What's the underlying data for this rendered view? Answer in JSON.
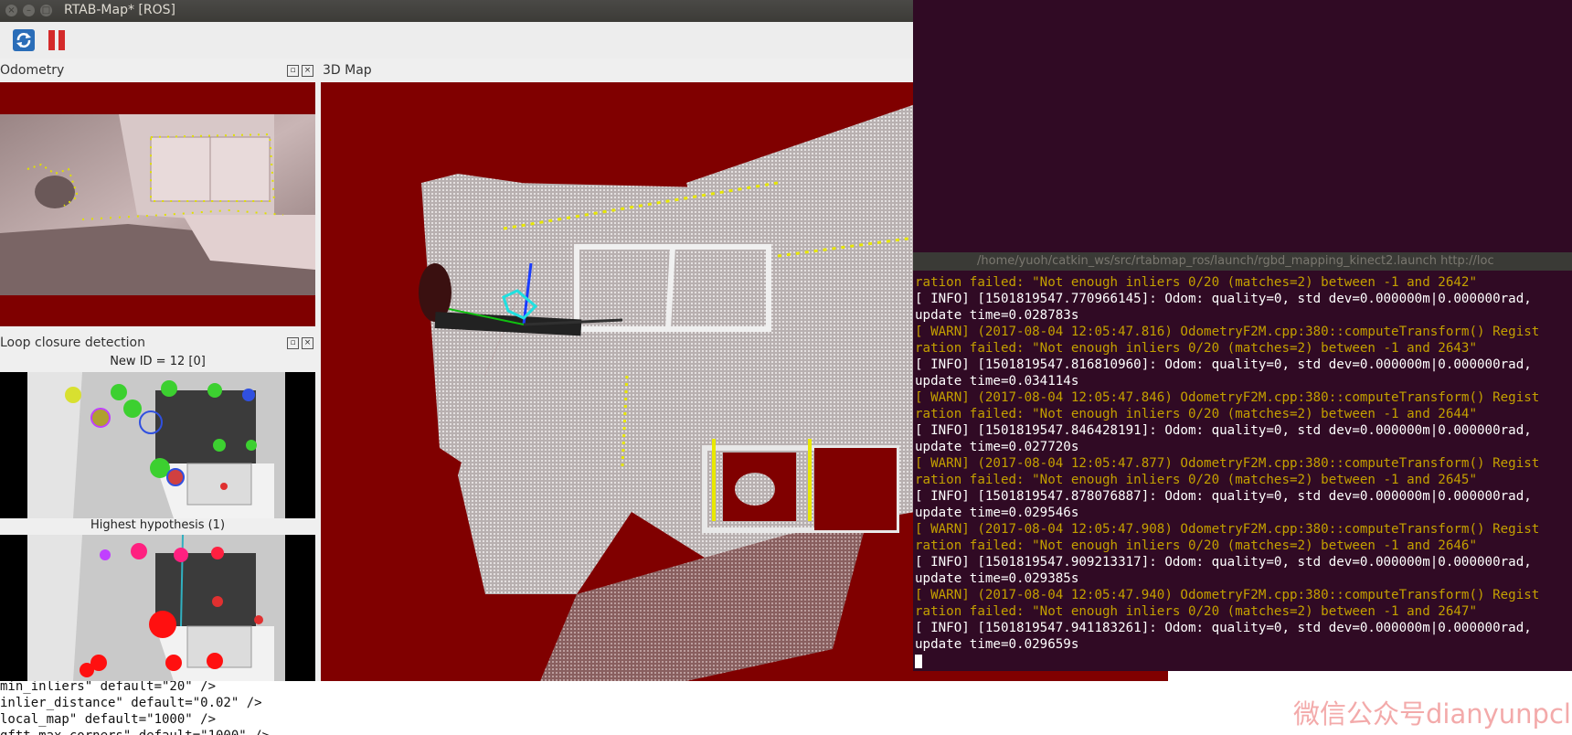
{
  "window": {
    "title": "RTAB-Map* [ROS]"
  },
  "toolbar": {
    "refresh_icon": "refresh-icon",
    "pause_icon": "pause-icon"
  },
  "docks": {
    "odometry": {
      "title": "Odometry"
    },
    "map3d": {
      "title": "3D Map"
    },
    "loop": {
      "title": "Loop closure detection",
      "new_id_caption": "New ID = 12 [0]",
      "hypothesis_caption": "Highest hypothesis (1)"
    }
  },
  "colors": {
    "view_background": "#800000",
    "terminal_bg": "#300a24",
    "warn": "#c4a000",
    "info": "#ffffff"
  },
  "terminal": {
    "title": "/home/yuoh/catkin_ws/src/rtabmap_ros/launch/rgbd_mapping_kinect2.launch http://loc",
    "lines": [
      {
        "type": "warn",
        "text": "ration failed: \"Not enough inliers 0/20 (matches=2) between -1 and 2642\""
      },
      {
        "type": "info",
        "text": "[ INFO] [1501819547.770966145]: Odom: quality=0, std dev=0.000000m|0.000000rad,"
      },
      {
        "type": "info",
        "text": "update time=0.028783s"
      },
      {
        "type": "warn",
        "text": "[ WARN] (2017-08-04 12:05:47.816) OdometryF2M.cpp:380::computeTransform() Regist"
      },
      {
        "type": "warn",
        "text": "ration failed: \"Not enough inliers 0/20 (matches=2) between -1 and 2643\""
      },
      {
        "type": "info",
        "text": "[ INFO] [1501819547.816810960]: Odom: quality=0, std dev=0.000000m|0.000000rad,"
      },
      {
        "type": "info",
        "text": "update time=0.034114s"
      },
      {
        "type": "warn",
        "text": "[ WARN] (2017-08-04 12:05:47.846) OdometryF2M.cpp:380::computeTransform() Regist"
      },
      {
        "type": "warn",
        "text": "ration failed: \"Not enough inliers 0/20 (matches=2) between -1 and 2644\""
      },
      {
        "type": "info",
        "text": "[ INFO] [1501819547.846428191]: Odom: quality=0, std dev=0.000000m|0.000000rad,"
      },
      {
        "type": "info",
        "text": "update time=0.027720s"
      },
      {
        "type": "warn",
        "text": "[ WARN] (2017-08-04 12:05:47.877) OdometryF2M.cpp:380::computeTransform() Regist"
      },
      {
        "type": "warn",
        "text": "ration failed: \"Not enough inliers 0/20 (matches=2) between -1 and 2645\""
      },
      {
        "type": "info",
        "text": "[ INFO] [1501819547.878076887]: Odom: quality=0, std dev=0.000000m|0.000000rad,"
      },
      {
        "type": "info",
        "text": "update time=0.029546s"
      },
      {
        "type": "warn",
        "text": "[ WARN] (2017-08-04 12:05:47.908) OdometryF2M.cpp:380::computeTransform() Regist"
      },
      {
        "type": "warn",
        "text": "ration failed: \"Not enough inliers 0/20 (matches=2) between -1 and 2646\""
      },
      {
        "type": "info",
        "text": "[ INFO] [1501819547.909213317]: Odom: quality=0, std dev=0.000000m|0.000000rad,"
      },
      {
        "type": "info",
        "text": "update time=0.029385s"
      },
      {
        "type": "warn",
        "text": "[ WARN] (2017-08-04 12:05:47.940) OdometryF2M.cpp:380::computeTransform() Regist"
      },
      {
        "type": "warn",
        "text": "ration failed: \"Not enough inliers 0/20 (matches=2) between -1 and 2647\""
      },
      {
        "type": "info",
        "text": "[ INFO] [1501819547.941183261]: Odom: quality=0, std dev=0.000000m|0.000000rad,"
      },
      {
        "type": "info",
        "text": "update time=0.029659s"
      }
    ]
  },
  "editor": {
    "lines": [
      "min_inliers\" default=\"20\" />",
      "inlier_distance\" default=\"0.02\" />",
      "local_map\" default=\"1000\" />",
      "gftt_max_corners\" default=\"1000\" />"
    ]
  },
  "watermark": "微信公众号dianyunpcl"
}
